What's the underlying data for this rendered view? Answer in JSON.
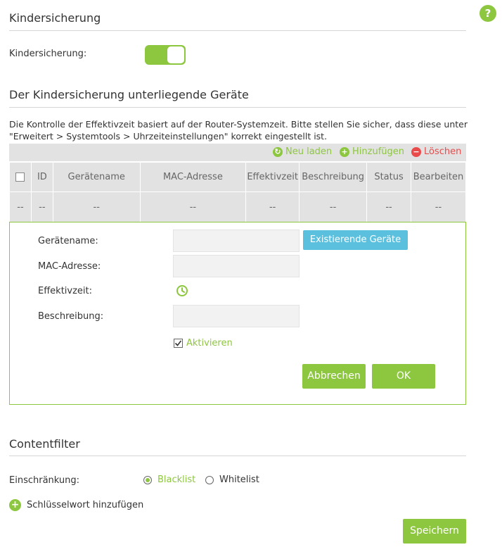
{
  "help": {
    "symbol": "?"
  },
  "parental": {
    "title": "Kindersicherung",
    "toggle_label": "Kindersicherung:",
    "toggle_on": true
  },
  "devices": {
    "title": "Der Kindersicherung unterliegende Geräte",
    "description": "Die Kontrolle der Effektivzeit basiert auf der Router-Systemzeit. Bitte stellen Sie sicher, dass diese unter \"Erweitert > Systemtools > Uhrzeiteinstellungen\" korrekt eingestellt ist.",
    "actions": {
      "reload": "Neu laden",
      "add": "Hinzufügen",
      "delete": "Löschen"
    },
    "columns": [
      "ID",
      "Gerätename",
      "MAC-Adresse",
      "Effektivzeit",
      "Beschreibung",
      "Status",
      "Bearbeiten"
    ],
    "row": [
      "--",
      "--",
      "--",
      "--",
      "--",
      "--",
      "--",
      "--"
    ]
  },
  "form": {
    "device_name_label": "Gerätename:",
    "mac_label": "MAC-Adresse:",
    "effective_time_label": "Effektivzeit:",
    "description_label": "Beschreibung:",
    "existing_devices_button": "Existierende Geräte",
    "enable_label": "Aktivieren",
    "enable_checked": true,
    "cancel_button": "Abbrechen",
    "ok_button": "OK"
  },
  "content_filter": {
    "title": "Contentfilter",
    "restriction_label": "Einschränkung:",
    "options": [
      "Blacklist",
      "Whitelist"
    ],
    "selected": "Blacklist",
    "add_keyword": "Schlüsselwort hinzufügen",
    "save_button": "Speichern"
  },
  "colors": {
    "accent": "#8dc63f",
    "info": "#5bc0de",
    "danger": "#e94b4b"
  },
  "icons": {
    "help": "help-icon",
    "reload": "refresh-icon",
    "add": "plus-circle-icon",
    "delete": "minus-circle-icon",
    "clock": "clock-icon",
    "checkbox": "checkbox-icon"
  }
}
